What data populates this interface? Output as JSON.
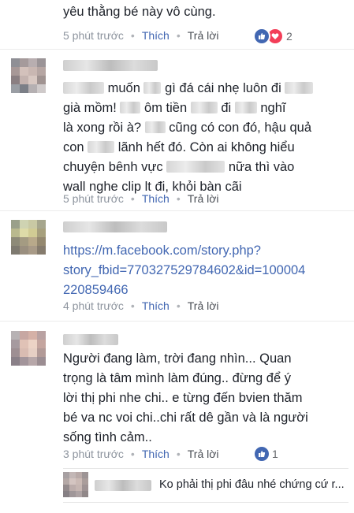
{
  "comments": [
    {
      "partial_text": "yêu thằng bé này vô cùng.",
      "time": "5 phút trước",
      "like_label": "Thích",
      "reply_label": "Trả lời",
      "reaction_count": "2"
    },
    {
      "lines": [
        {
          "after_blur1": "muốn",
          "after_blur2": "gì đá cái nhẹ luôn đi"
        },
        {
          "t1": "già mồm!",
          "t2": "ôm tiền",
          "t3": "đi",
          "t4": "nghĩ"
        },
        {
          "t1": "là xong rồi à?",
          "t2": "cũng có con đó, hậu quả"
        },
        {
          "t1": "con",
          "t2": "lãnh hết đó. Còn ai không hiểu"
        },
        {
          "t1": "chuyện bênh vực",
          "t2": "nữa thì vào"
        },
        {
          "t1": "wall nghe clip lt đi, khỏi bàn cãi"
        }
      ],
      "time": "5 phút trước",
      "like_label": "Thích",
      "reply_label": "Trả lời"
    },
    {
      "link_lines": [
        "https://m.facebook.com/story.php?",
        "story_fbid=770327529784602&id=100004",
        "220859466"
      ],
      "time": "4 phút trước",
      "like_label": "Thích",
      "reply_label": "Trả lời"
    },
    {
      "lines": [
        "Người đang làm, trời đang nhìn... Quan",
        "trọng là tâm mình làm đúng.. đừng để ý",
        "lời thị phi nhe chi.. e từng đến bvien thăm",
        "bé va nc voi chi..chi rất dê gần và là người",
        "sống tình cảm.."
      ],
      "time": "3 phút trước",
      "like_label": "Thích",
      "reply_label": "Trả lời",
      "reaction_count": "1"
    }
  ],
  "reply_preview": {
    "text": "Ko phải thị phi đâu nhé chứng cứ r..."
  },
  "colors": {
    "link": "#4267b2",
    "like_blue": "#4267b2",
    "love_red": "#f33e58",
    "meta_gray": "#8d949e"
  },
  "icons": {
    "like": "thumbs-up-icon",
    "love": "heart-icon"
  }
}
